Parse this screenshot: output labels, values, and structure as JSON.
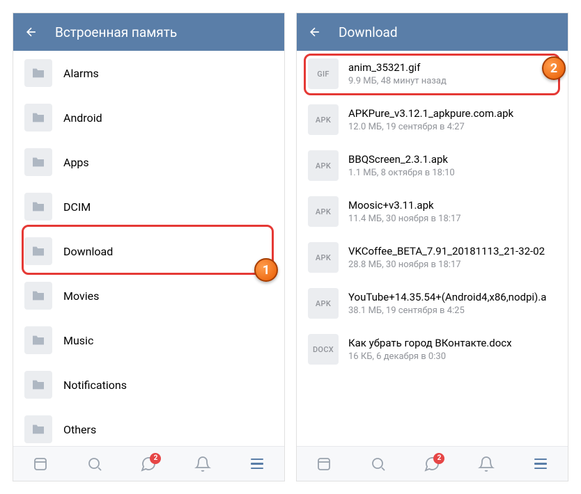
{
  "left": {
    "title": "Встроенная память",
    "folders": [
      {
        "name": "Alarms"
      },
      {
        "name": "Android"
      },
      {
        "name": "Apps"
      },
      {
        "name": "DCIM"
      },
      {
        "name": "Download"
      },
      {
        "name": "Movies"
      },
      {
        "name": "Music"
      },
      {
        "name": "Notifications"
      },
      {
        "name": "Others"
      }
    ]
  },
  "right": {
    "title": "Download",
    "files": [
      {
        "type": "GIF",
        "name": "anim_35321.gif",
        "meta": "9.9 МБ, 48 минут назад"
      },
      {
        "type": "APK",
        "name": "APKPure_v3.12.1_apkpure.com.apk",
        "meta": "12.0 МБ, 19 сентября в 4:27"
      },
      {
        "type": "APK",
        "name": "BBQScreen_2.3.1.apk",
        "meta": "1.1 МБ, 8 октября в 18:10"
      },
      {
        "type": "APK",
        "name": "Moosic+v3.11.apk",
        "meta": "11.4 МБ, 30 ноября в 18:17"
      },
      {
        "type": "APK",
        "name": "VKCoffee_BETA_7.91_20181113_21-32-02",
        "meta": "28.8 МБ, 30 ноября в 18:17"
      },
      {
        "type": "APK",
        "name": "YouTube+14.35.54+(Android4,x86,nodpi).a",
        "meta": "38.1 МБ, 19 сентября в 4:25"
      },
      {
        "type": "DOCX",
        "name": "Как убрать город ВКонтакте.docx",
        "meta": "16 КБ, 6 декабря в 0:30"
      }
    ]
  },
  "nav": {
    "messages_badge": "2"
  },
  "steps": {
    "one": "1",
    "two": "2"
  }
}
